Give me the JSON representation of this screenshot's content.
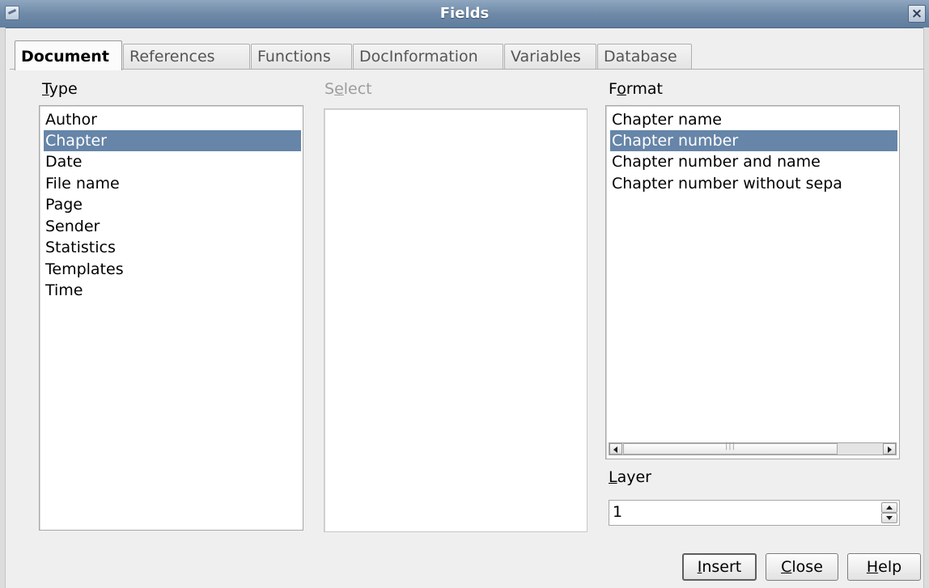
{
  "window": {
    "title": "Fields",
    "close_glyph": "×"
  },
  "tabs": [
    {
      "label": "Document",
      "active": true
    },
    {
      "label": "References",
      "active": false
    },
    {
      "label": "Functions",
      "active": false
    },
    {
      "label": "DocInformation",
      "active": false
    },
    {
      "label": "Variables",
      "active": false
    },
    {
      "label": "Database",
      "active": false
    }
  ],
  "type": {
    "label_mnemonic": "T",
    "label_rest": "ype",
    "items": [
      "Author",
      "Chapter",
      "Date",
      "File name",
      "Page",
      "Sender",
      "Statistics",
      "Templates",
      "Time"
    ],
    "selected": "Chapter"
  },
  "select": {
    "label_pre": "S",
    "label_mnemonic": "e",
    "label_rest": "lect",
    "enabled": false,
    "items": []
  },
  "format": {
    "label_pre": "F",
    "label_mnemonic": "o",
    "label_rest": "rmat",
    "items": [
      "Chapter name",
      "Chapter number",
      "Chapter number and name",
      "Chapter number without sepa"
    ],
    "selected": "Chapter number"
  },
  "layer": {
    "label_mnemonic": "L",
    "label_rest": "ayer",
    "value": "1"
  },
  "buttons": {
    "insert_mnemonic": "I",
    "insert_rest": "nsert",
    "close_mnemonic": "C",
    "close_rest": "lose",
    "help_mnemonic": "H",
    "help_rest": "elp"
  },
  "colors": {
    "selection": "#6685a8",
    "titlebar": "#6f8aa8"
  }
}
